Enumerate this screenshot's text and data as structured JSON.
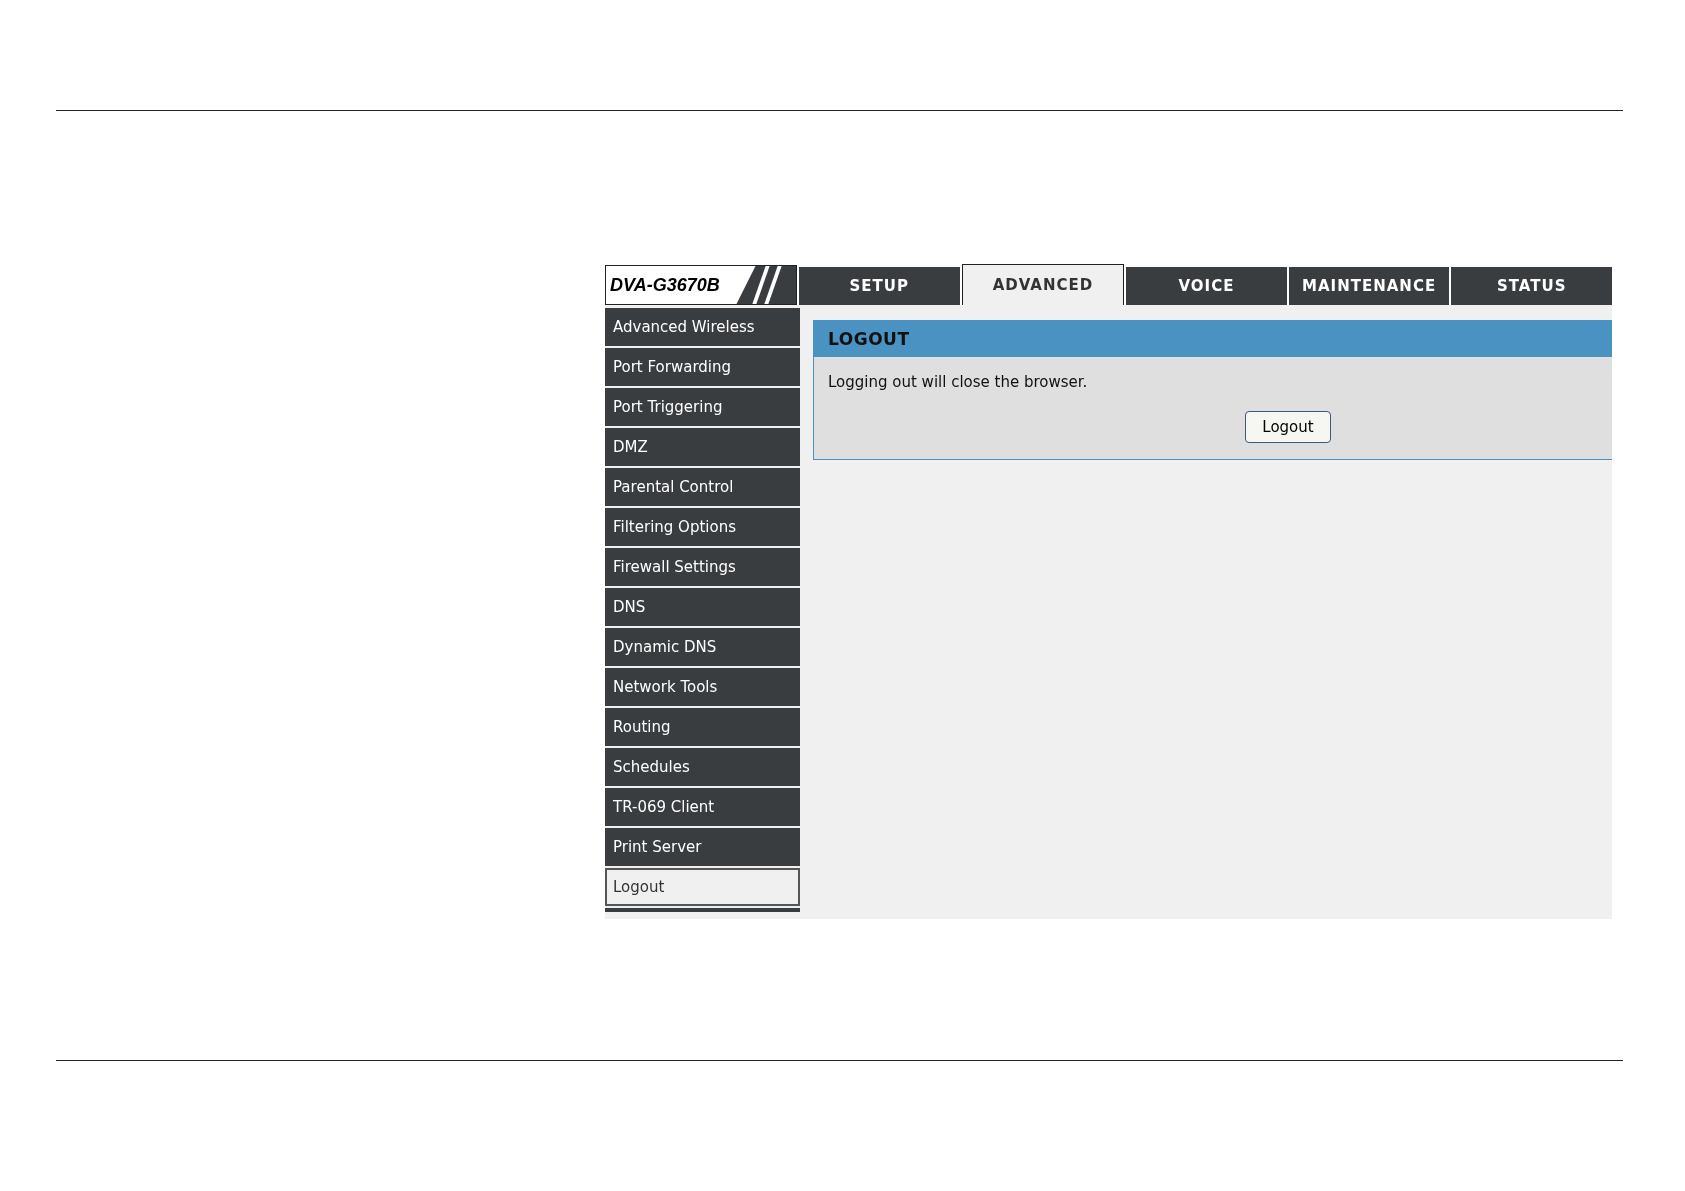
{
  "model": "DVA-G3670B",
  "tabs": [
    {
      "label": "SETUP",
      "selected": false
    },
    {
      "label": "ADVANCED",
      "selected": true
    },
    {
      "label": "VOICE",
      "selected": false
    },
    {
      "label": "MAINTENANCE",
      "selected": false
    },
    {
      "label": "STATUS",
      "selected": false
    }
  ],
  "sidebar": {
    "items": [
      {
        "label": "Advanced Wireless",
        "selected": false
      },
      {
        "label": "Port Forwarding",
        "selected": false
      },
      {
        "label": "Port Triggering",
        "selected": false
      },
      {
        "label": "DMZ",
        "selected": false
      },
      {
        "label": "Parental Control",
        "selected": false
      },
      {
        "label": "Filtering Options",
        "selected": false
      },
      {
        "label": "Firewall Settings",
        "selected": false
      },
      {
        "label": "DNS",
        "selected": false
      },
      {
        "label": "Dynamic DNS",
        "selected": false
      },
      {
        "label": "Network Tools",
        "selected": false
      },
      {
        "label": "Routing",
        "selected": false
      },
      {
        "label": "Schedules",
        "selected": false
      },
      {
        "label": "TR-069 Client",
        "selected": false
      },
      {
        "label": "Print Server",
        "selected": false
      },
      {
        "label": "Logout",
        "selected": true
      }
    ]
  },
  "panel": {
    "title": "LOGOUT",
    "message": "Logging out will close the browser.",
    "button": "Logout"
  }
}
